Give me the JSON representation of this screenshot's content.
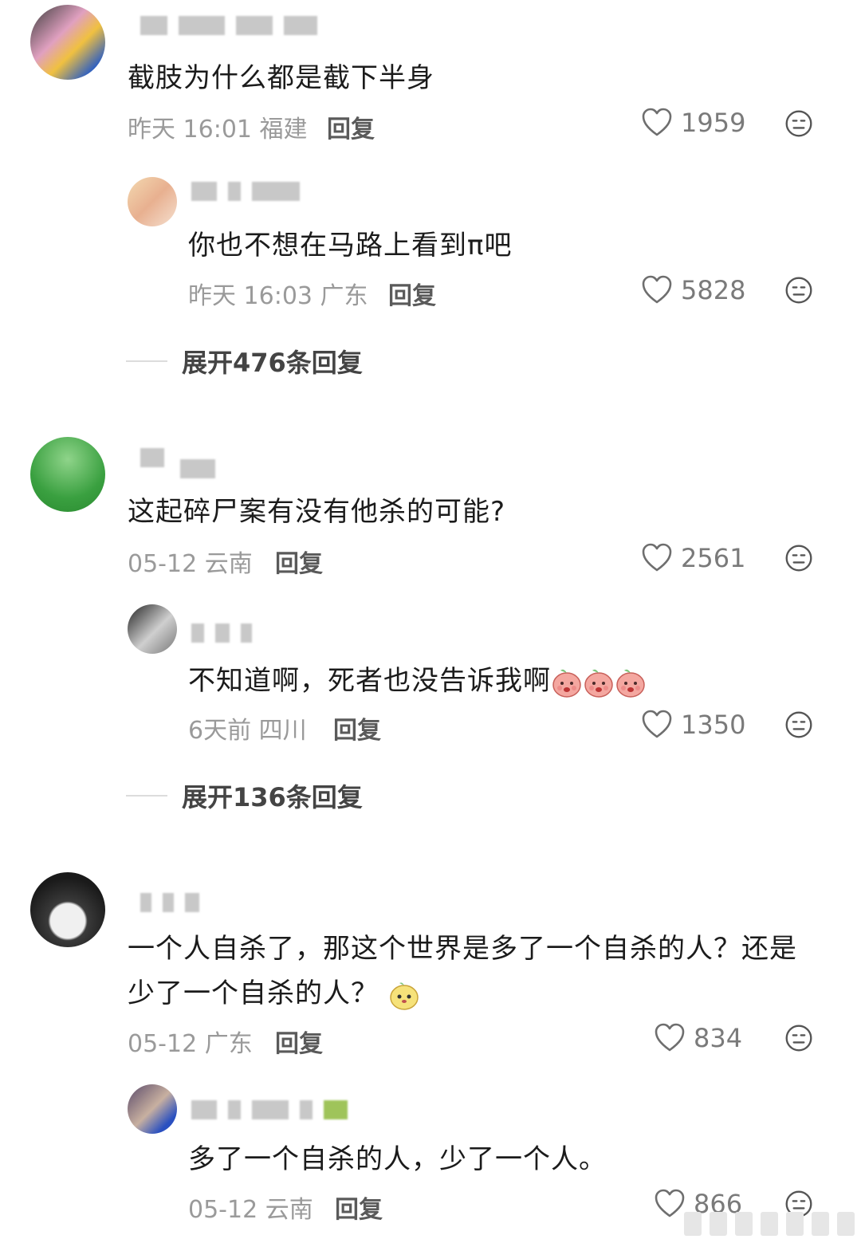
{
  "comments": [
    {
      "text": "截肢为什么都是截下半身",
      "time": "昨天 16:01",
      "location": "福建",
      "reply_label": "回复",
      "likes": "1959",
      "replies": [
        {
          "text": "你也不想在马路上看到π吧",
          "time": "昨天 16:03",
          "location": "广东",
          "reply_label": "回复",
          "likes": "5828"
        }
      ],
      "expand_label": "展开476条回复"
    },
    {
      "text": "这起碎尸案有没有他杀的可能?",
      "time": "05-12",
      "location": "云南",
      "reply_label": "回复",
      "likes": "2561",
      "replies": [
        {
          "text": "不知道啊，死者也没告诉我啊",
          "time": "6天前",
          "location": "四川",
          "reply_label": "回复",
          "likes": "1350"
        }
      ],
      "expand_label": "展开136条回复"
    },
    {
      "text_line1": "一个人自杀了，那这个世界是多了一个自杀的人？还是",
      "text_line2": "少了一个自杀的人？",
      "time": "05-12",
      "location": "广东",
      "reply_label": "回复",
      "likes": "834",
      "replies": [
        {
          "text": "多了一个自杀的人，少了一个人。",
          "time": "05-12",
          "location": "云南",
          "reply_label": "回复",
          "likes": "866"
        }
      ]
    }
  ],
  "icons": {
    "like": "heart-outline-icon",
    "dislike": "meh-face-icon"
  },
  "colors": {
    "text": "#1b1b1b",
    "meta": "#9a9a9a",
    "reply": "#5a5a5a"
  }
}
